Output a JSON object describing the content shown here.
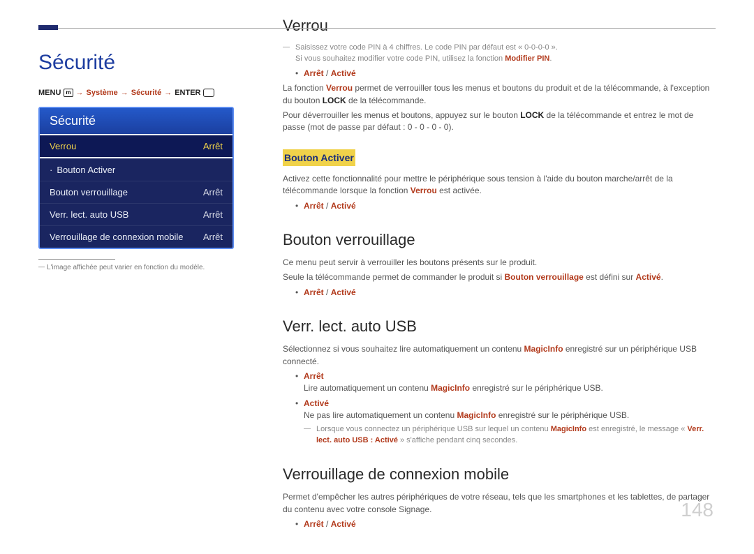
{
  "page_number": "148",
  "left": {
    "title": "Sécurité",
    "breadcrumb": {
      "menu": "MENU",
      "p1": "Système",
      "p2": "Sécurité",
      "enter": "ENTER"
    },
    "panel": {
      "title": "Sécurité",
      "rows": [
        {
          "label": "Verrou",
          "value": "Arrêt",
          "selected": true
        },
        {
          "label": "Bouton Activer",
          "value": "",
          "dot": true
        },
        {
          "label": "Bouton verrouillage",
          "value": "Arrêt"
        },
        {
          "label": "Verr. lect. auto USB",
          "value": "Arrêt"
        },
        {
          "label": "Verrouillage de connexion mobile",
          "value": "Arrêt"
        }
      ]
    },
    "footnote": "L'image affichée peut varier en fonction du modèle."
  },
  "right": {
    "verrou": {
      "heading": "Verrou",
      "note1_a": "Saisissez votre code PIN à 4 chiffres. Le code PIN par défaut est « 0-0-0-0 ».",
      "note1_b_pre": "Si vous souhaitez modifier votre code PIN, utilisez la fonction ",
      "note1_b_bold": "Modifier PIN",
      "note1_b_post": ".",
      "opt_arret": "Arrêt",
      "opt_slash": " / ",
      "opt_active": "Activé",
      "p1_pre": "La fonction ",
      "p1_red": "Verrou",
      "p1_mid": " permet de verrouiller tous les menus et boutons du produit et de la télécommande, à l'exception du bouton ",
      "p1_bold": "LOCK",
      "p1_post": " de la télécommande.",
      "p2_pre": "Pour déverrouiller les menus et boutons, appuyez sur le bouton ",
      "p2_bold": "LOCK",
      "p2_post": " de la télécommande et entrez le mot de passe (mot de passe par défaut : 0 - 0 - 0 - 0).",
      "sub_label": "Bouton Activer",
      "sub_p_pre": "Activez cette fonctionnalité pour mettre le périphérique sous tension à l'aide du bouton marche/arrêt de la télécommande lorsque la fonction ",
      "sub_p_red": "Verrou",
      "sub_p_post": " est activée.",
      "sub_opt_arret": "Arrêt",
      "sub_opt_active": "Activé"
    },
    "bverr": {
      "heading": "Bouton verrouillage",
      "p1": "Ce menu peut servir à verrouiller les boutons présents sur le produit.",
      "p2_pre": "Seule la télécommande permet de commander le produit si ",
      "p2_red1": "Bouton verrouillage",
      "p2_mid": " est défini sur ",
      "p2_red2": "Activé",
      "p2_post": ".",
      "opt_arret": "Arrêt",
      "opt_active": "Activé"
    },
    "usb": {
      "heading": "Verr. lect. auto USB",
      "p1_pre": "Sélectionnez si vous souhaitez lire automatiquement un contenu ",
      "p1_red": "MagicInfo",
      "p1_post": " enregistré sur un périphérique USB connecté.",
      "b1_label": "Arrêt",
      "b1_text_pre": "Lire automatiquement un contenu ",
      "b1_text_red": "MagicInfo",
      "b1_text_post": " enregistré sur le périphérique USB.",
      "b2_label": "Activé",
      "b2_text_pre": "Ne pas lire automatiquement un contenu ",
      "b2_text_red": "MagicInfo",
      "b2_text_post": " enregistré sur le périphérique USB.",
      "note_pre": "Lorsque vous connectez un périphérique USB sur lequel un contenu ",
      "note_red1": "MagicInfo",
      "note_mid": " est enregistré, le message « ",
      "note_red2": "Verr. lect. auto USB : Activé",
      "note_post": " » s'affiche pendant cinq secondes."
    },
    "mobile": {
      "heading": "Verrouillage de connexion mobile",
      "p1": "Permet d'empêcher les autres périphériques de votre réseau, tels que les smartphones et les tablettes, de partager du contenu avec votre console Signage.",
      "opt_arret": "Arrêt",
      "opt_active": "Activé"
    }
  }
}
